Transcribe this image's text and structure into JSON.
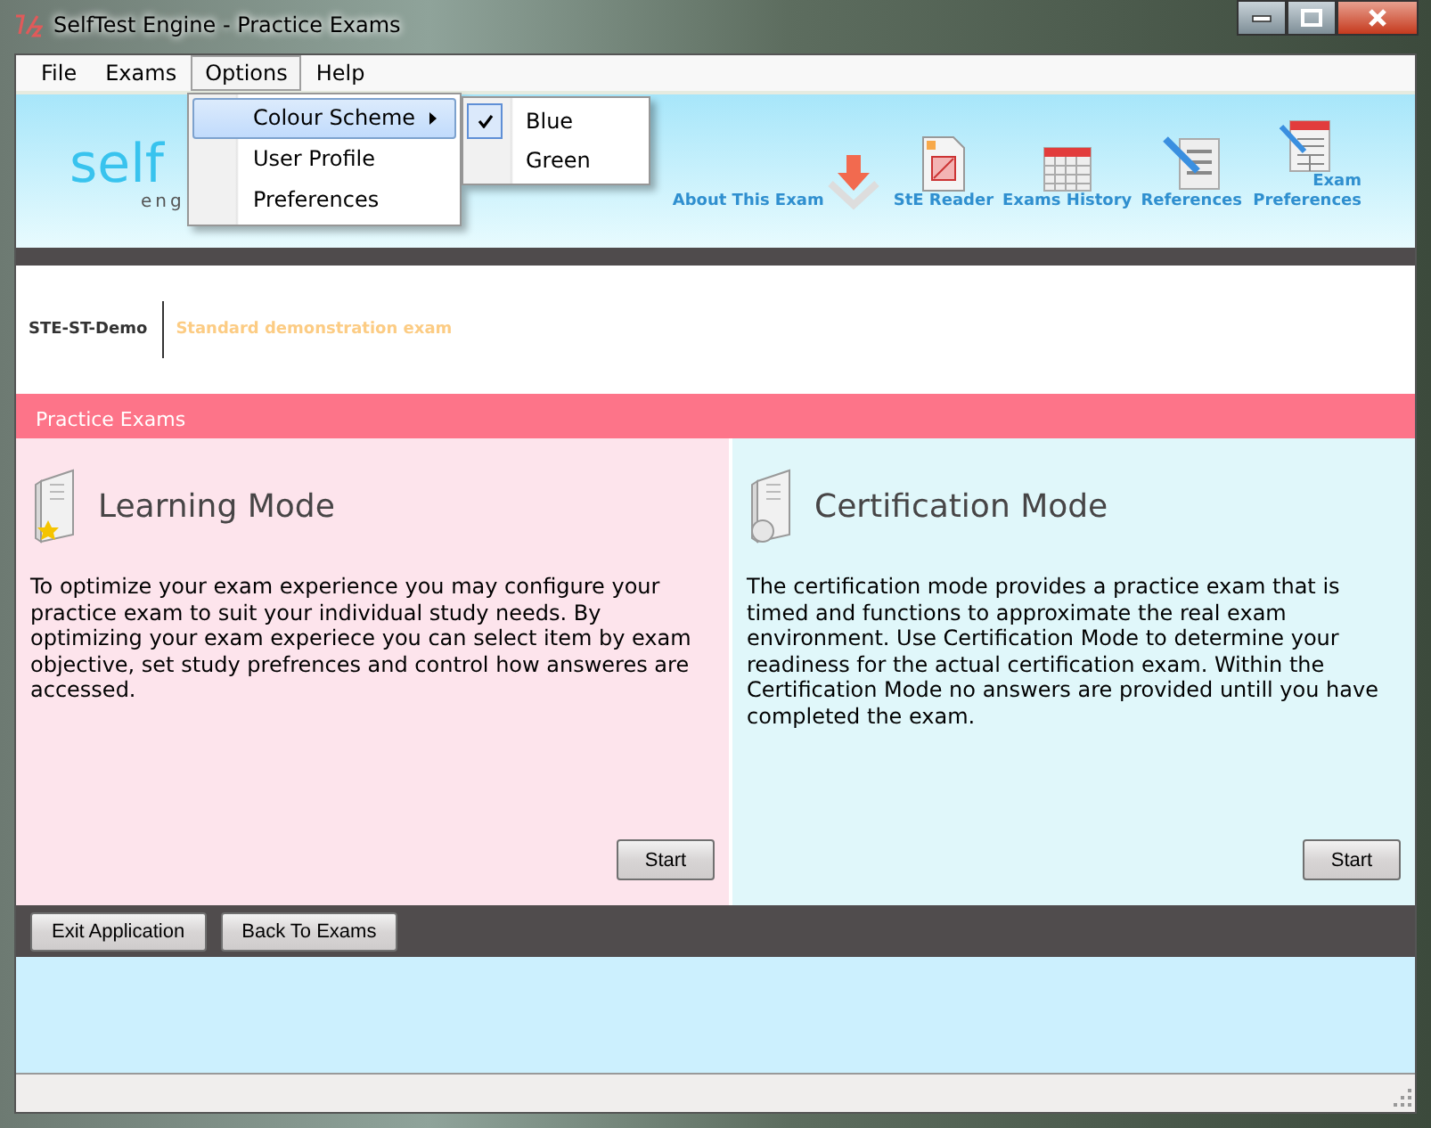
{
  "window": {
    "title": "SelfTest Engine - Practice Exams"
  },
  "menu_bar": [
    {
      "label": "File",
      "selected": false
    },
    {
      "label": "Exams",
      "selected": false
    },
    {
      "label": "Options",
      "selected": true
    },
    {
      "label": "Help",
      "selected": false
    }
  ],
  "open_menu": {
    "items": [
      {
        "label": "Colour Scheme",
        "selected": true,
        "submenu": true
      },
      {
        "label": "User Profile",
        "selected": false,
        "submenu": false
      },
      {
        "label": "Preferences",
        "selected": false,
        "submenu": false
      }
    ],
    "submenu": [
      {
        "label": "Blue",
        "checked": true
      },
      {
        "label": "Green",
        "checked": false
      }
    ]
  },
  "logo": {
    "main": "self",
    "sub": "eng"
  },
  "toolbar": [
    {
      "kind": "about",
      "label": "About This Exam"
    },
    {
      "kind": "reader",
      "label": "StE Reader"
    },
    {
      "kind": "history",
      "label": "Exams History"
    },
    {
      "kind": "references",
      "label": "References"
    },
    {
      "kind": "preferences",
      "label": "Exam Preferences"
    }
  ],
  "exam": {
    "code": "STE-ST-Demo",
    "description": "Standard demonstration exam"
  },
  "section_title": "Practice Exams",
  "modes": [
    {
      "kind": "learning",
      "title": "Learning Mode",
      "text": "To optimize your exam experience you may configure your practice exam to suit your individual study needs. By optimizing your exam experiece you can select item by exam objective, set study prefrences and control how answeres are accessed.",
      "button": "Start"
    },
    {
      "kind": "certification",
      "title": "Certification Mode",
      "text": "The certification mode provides a practice exam that is timed and functions to approximate the real exam environment. Use Certification Mode to determine your readiness for the actual  certification exam. Within the Certification Mode no answers are provided untill you have completed the exam.",
      "button": "Start"
    }
  ],
  "bottom_buttons": [
    "Exit Application",
    "Back To Exams"
  ]
}
